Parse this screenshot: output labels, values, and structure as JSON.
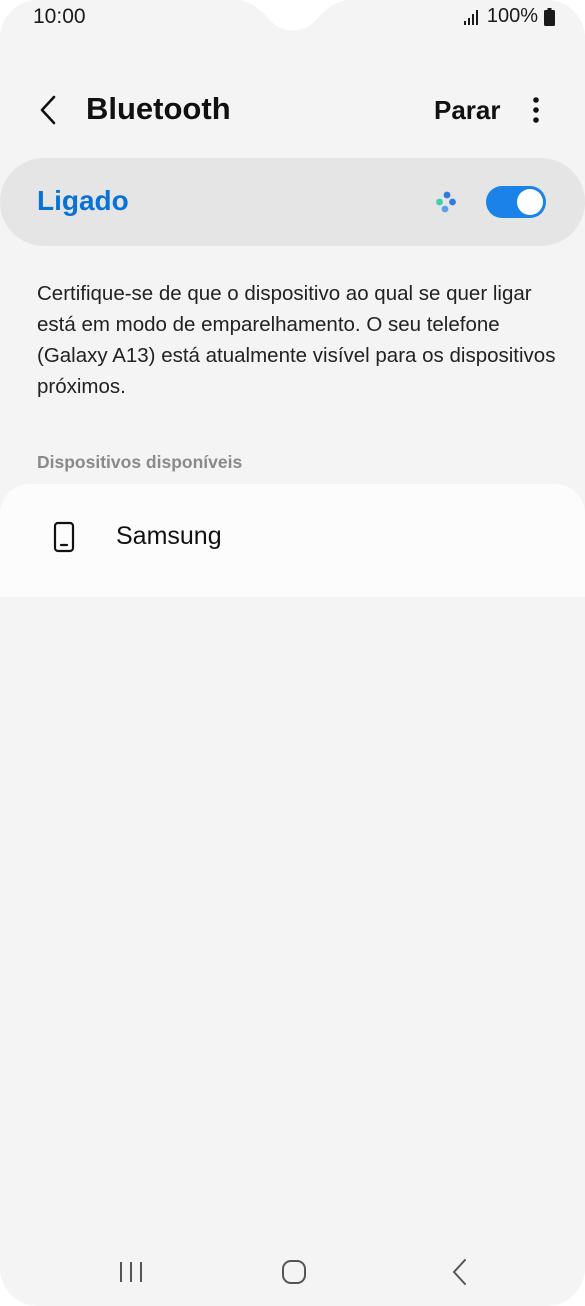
{
  "status_bar": {
    "time": "10:00",
    "battery": "100%"
  },
  "header": {
    "title": "Bluetooth",
    "stop_label": "Parar"
  },
  "master_toggle": {
    "label": "Ligado",
    "state": "on",
    "accent_color": "#0a72d6"
  },
  "description": "Certifique-se de que o dispositivo ao qual se quer ligar está em modo de emparelhamento. O seu telefone (Galaxy A13) está atualmente visível para os dispositivos próximos.",
  "available_devices": {
    "header": "Dispositivos disponíveis",
    "items": [
      {
        "name": "Samsung",
        "icon": "phone-icon"
      }
    ]
  },
  "icons": {
    "back": "chevron-left-icon",
    "more": "more-vertical-icon",
    "scan": "scanning-dots-icon",
    "nav_recents": "recents-icon",
    "nav_home": "home-icon",
    "nav_back": "back-icon"
  }
}
